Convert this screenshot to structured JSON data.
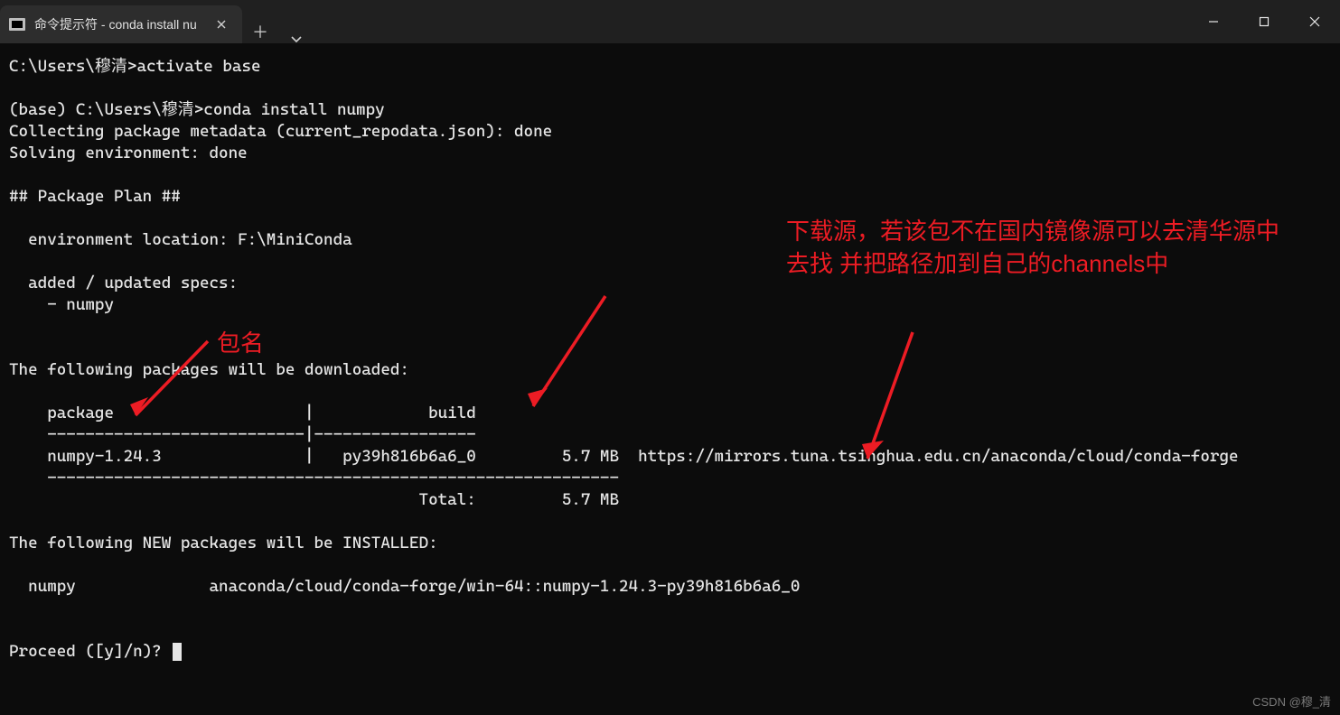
{
  "titlebar": {
    "tab_title": "命令提示符 - conda  install nu"
  },
  "terminal": {
    "line_prompt1": "C:\\Users\\穆清>activate base",
    "line_blank": "",
    "line_prompt2": "(base) C:\\Users\\穆清>conda install numpy",
    "line_collect": "Collecting package metadata (current_repodata.json): done",
    "line_solve": "Solving environment: done",
    "line_plan": "## Package Plan ##",
    "line_env": "  environment location: F:\\MiniConda",
    "line_added": "  added / updated specs:",
    "line_spec": "    - numpy",
    "line_following_dl": "The following packages will be downloaded:",
    "hdr_package": "    package                    |            build",
    "hdr_sep": "    ---------------------------|-----------------",
    "row_pkg": "    numpy-1.24.3               |   py39h816b6a6_0         5.7 MB  https://mirrors.tuna.tsinghua.edu.cn/anaconda/cloud/conda-forge",
    "row_sep": "    ------------------------------------------------------------",
    "row_total": "                                           Total:         5.7 MB",
    "line_following_new": "The following NEW packages will be INSTALLED:",
    "line_install": "  numpy              anaconda/cloud/conda-forge/win-64::numpy-1.24.3-py39h816b6a6_0",
    "line_proceed": "Proceed ([y]/n)? "
  },
  "annotations": {
    "label_pkg": "包名",
    "label_source": "下载源，若该包不在国内镜像源可以去清华源中去找 并把路径加到自己的channels中"
  },
  "watermark": "CSDN @穆_清"
}
